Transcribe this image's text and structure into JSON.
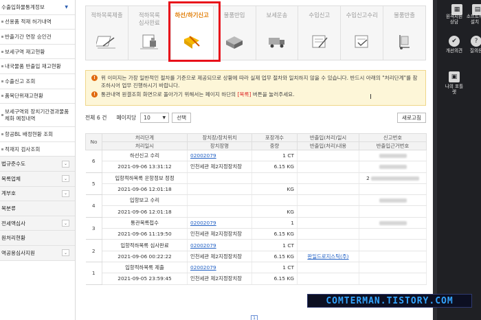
{
  "sidebar": {
    "items": [
      {
        "label": "수출입화물통계정보",
        "type": "top"
      },
      {
        "label": "선용품 적재 허가내역",
        "type": "dot"
      },
      {
        "label": "반출기간 연장 승인건",
        "type": "dot"
      },
      {
        "label": "보세구역 재고현황",
        "type": "dot"
      },
      {
        "label": "내국물품 반출입 재고현황",
        "type": "dot"
      },
      {
        "label": "수출신고 조회",
        "type": "dot"
      },
      {
        "label": "품목단위재고현황",
        "type": "dot"
      },
      {
        "label": "보세구역외 장치기간경과물품 체화 예정내역",
        "type": "dot-tall"
      },
      {
        "label": "항공BL 배정현황 조회",
        "type": "dot"
      },
      {
        "label": "적재지 검사조회",
        "type": "dot"
      },
      {
        "label": "법규준수도",
        "type": "group"
      },
      {
        "label": "목록업체",
        "type": "group"
      },
      {
        "label": "계부호",
        "type": "group"
      },
      {
        "label": "목분류",
        "type": "group-plain"
      },
      {
        "label": "전세액심사",
        "type": "group"
      },
      {
        "label": "원처리현황",
        "type": "group-plain"
      },
      {
        "label": "역공용심사지원",
        "type": "group"
      }
    ]
  },
  "steps": [
    {
      "label": "적하목록제출",
      "icon": "document-pen-icon"
    },
    {
      "label": "적하목록\n심사완료",
      "icon": "document-stamp-icon"
    },
    {
      "label": "하선/하기신고",
      "icon": "folder-pen-icon",
      "active": true
    },
    {
      "label": "물품반입",
      "icon": "boxes-icon"
    },
    {
      "label": "보세운송",
      "icon": "truck-icon"
    },
    {
      "label": "수입신고",
      "icon": "form-pen-icon"
    },
    {
      "label": "수입신고수리",
      "icon": "form-check-icon"
    },
    {
      "label": "물품반출",
      "icon": "dolly-icon"
    }
  ],
  "notice": {
    "line1_prefix": "위 이미지는 가장 일반적인 절차를 기준으로 제공되므로 상황에 따라 실제 업무 절차와 일치하지 않을 수 있습니다. 반드시 아래의 \"처리단계\"를 참조하시어 업무 진행하시기 바랍니다.",
    "line2_prefix": "통관내역 원결조회 화면으로 돌아가기 위해서는 페이지 하단의 ",
    "line2_highlight": "[목록]",
    "line2_suffix": " 버튼을 눌러주세요."
  },
  "toolbar": {
    "total_label": "전체 6 건",
    "per_page_label": "페이지당",
    "per_page_value": "10",
    "select_button": "선택",
    "refresh_button": "새로고침"
  },
  "table": {
    "headers_top": [
      "No",
      "처리단계",
      "장치장/장치위치",
      "포장개수",
      "반출입(처리)일시",
      "신고번호"
    ],
    "headers_bottom": [
      "처리일시",
      "장치장명",
      "중량",
      "반출입(처리)내용",
      "반출입근거번호"
    ],
    "rows": [
      {
        "no": "6",
        "stage": "하선신고 수리",
        "datetime": "2021-09-06 13:31:12",
        "loc_code": "02002079",
        "loc_name": "인천세관 제2지정장치장",
        "pkg": "1 CT",
        "weight": "6.15 KG",
        "inout": "",
        "inout_content": "",
        "decl": "blur",
        "basis": "blur"
      },
      {
        "no": "5",
        "stage": "입항적하목록 운항정보 정정",
        "datetime": "2021-09-06 12:01:18",
        "loc_code": "",
        "loc_name": "",
        "pkg": "",
        "weight": "KG",
        "inout": "",
        "inout_content": "",
        "decl": "2blur",
        "basis": ""
      },
      {
        "no": "4",
        "stage": "입항보고 수리",
        "datetime": "2021-09-06 12:01:18",
        "loc_code": "",
        "loc_name": "",
        "pkg": "",
        "weight": "KG",
        "inout": "",
        "inout_content": "",
        "decl": "blur",
        "basis": ""
      },
      {
        "no": "3",
        "stage": "통관목록접수",
        "datetime": "2021-09-06 11:19:50",
        "loc_code": "02002079",
        "loc_name": "인천세관 제2지정장치장",
        "pkg": "1",
        "weight": "6.15 KG",
        "inout": "",
        "inout_content": "",
        "decl": "blur",
        "basis": ""
      },
      {
        "no": "2",
        "stage": "입항적하목록 심사완료",
        "datetime": "2021-09-06 00:22:22",
        "loc_code": "02002079",
        "loc_name": "인천세관 제2지정장치장",
        "pkg": "1 CT",
        "weight": "6.15 KG",
        "inout": "",
        "inout_content": "판일드로지스틱(주)",
        "decl": "",
        "basis": ""
      },
      {
        "no": "1",
        "stage": "입항적하목록 제출",
        "datetime": "2021-09-05 23:59:45",
        "loc_code": "02002079",
        "loc_name": "인천세관 제2지정장치장",
        "pkg": "1 CT",
        "weight": "6.15 KG",
        "inout": "",
        "inout_content": "",
        "decl": "",
        "basis": ""
      }
    ]
  },
  "pager": {
    "current": "1"
  },
  "right_panel": {
    "items": [
      {
        "label": "",
        "icon": "gallery-icon"
      },
      {
        "label": "",
        "icon": "doc-icon"
      },
      {
        "label": "원격지원\n상담",
        "icon": "remote-support-icon"
      },
      {
        "label": "소프트웨\n설치",
        "icon": "software-install-icon"
      },
      {
        "label": "개선의견",
        "icon": "feedback-icon"
      },
      {
        "label": "질의응",
        "icon": "qna-icon"
      },
      {
        "label": "나의 포틀\n렛",
        "icon": "portlet-icon"
      }
    ]
  },
  "watermark": "COMTERMAN.TISTORY.COM",
  "colors": {
    "highlight": "#e8101a",
    "active_step": "#e07a00",
    "link": "#1f5fc4",
    "notice_bg": "#fdf6d8"
  }
}
